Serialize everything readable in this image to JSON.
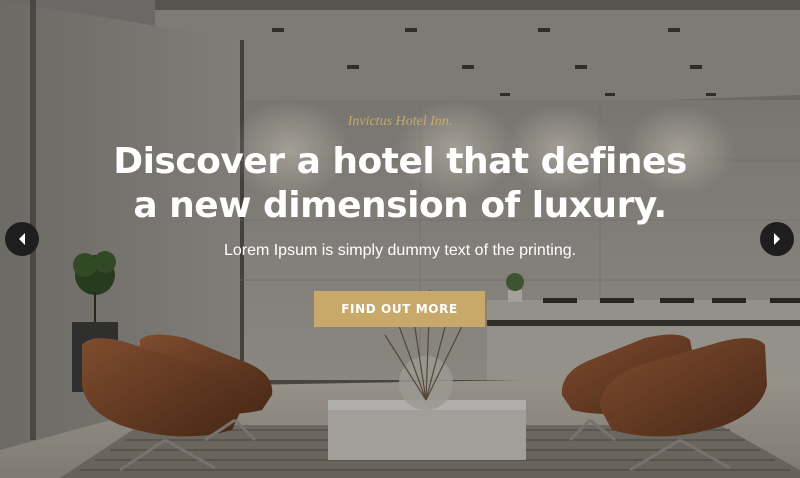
{
  "hero": {
    "eyebrow": "Invictus Hotel Inn.",
    "headline_line1": "Discover a hotel that defines",
    "headline_line2": "a new dimension of luxury.",
    "subtext": "Lorem Ipsum is simply dummy text of the printing.",
    "cta_label": "FIND OUT MORE"
  },
  "slider": {
    "prev_icon": "chevron-left-icon",
    "next_icon": "chevron-right-icon"
  },
  "colors": {
    "accent": "#c8a96a",
    "headline": "#ffffff",
    "arrow_bg": "#1e1e1e"
  }
}
